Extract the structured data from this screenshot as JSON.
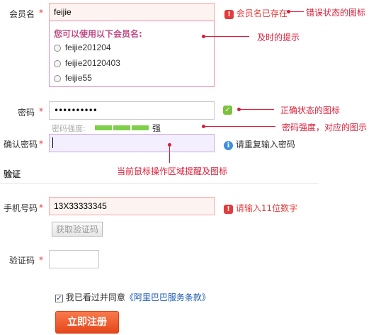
{
  "username": {
    "label": "会员名",
    "required": "*",
    "value": "feijie",
    "error_text": "会员名已存在",
    "suggest_title": "您可以使用以下会员名:",
    "suggestions": [
      "feijie201204",
      "feijie20120403",
      "feijie55"
    ]
  },
  "password": {
    "label": "密码",
    "required": "*",
    "value": "••••••••••",
    "strength_label": "密码强度:",
    "strength_text": "强",
    "strength_level": 1.0
  },
  "confirm": {
    "label": "确认密码",
    "required": "*",
    "value": "",
    "hint": "请重复输入密码"
  },
  "verify_section": {
    "title": "验证"
  },
  "phone": {
    "label": "手机号码",
    "required": "*",
    "value": "13X33333345",
    "error_text": "请输入11位数字",
    "get_code_label": "获取验证码"
  },
  "code": {
    "label": "验证码",
    "required": "*",
    "value": ""
  },
  "agreement": {
    "text": "我已看过并同意",
    "link": "《阿里巴巴服务条款》",
    "checked": true
  },
  "submit": {
    "label": "立即注册"
  },
  "annotations": {
    "error_icon": "错误状态的图标",
    "timely_hint": "及时的提示",
    "correct_icon": "正确状态的图标",
    "strength": "密码强度，对应的图示",
    "focus_area": "当前鼠标操作区域提醒及图标"
  },
  "colors": {
    "error": "#e33b3b",
    "success": "#7cc23f",
    "info": "#3e8fdc",
    "annotation": "#d91e38",
    "submit": "#e5461b"
  },
  "icons": {
    "error": "exclamation-icon",
    "success": "check-icon",
    "info": "info-icon"
  }
}
